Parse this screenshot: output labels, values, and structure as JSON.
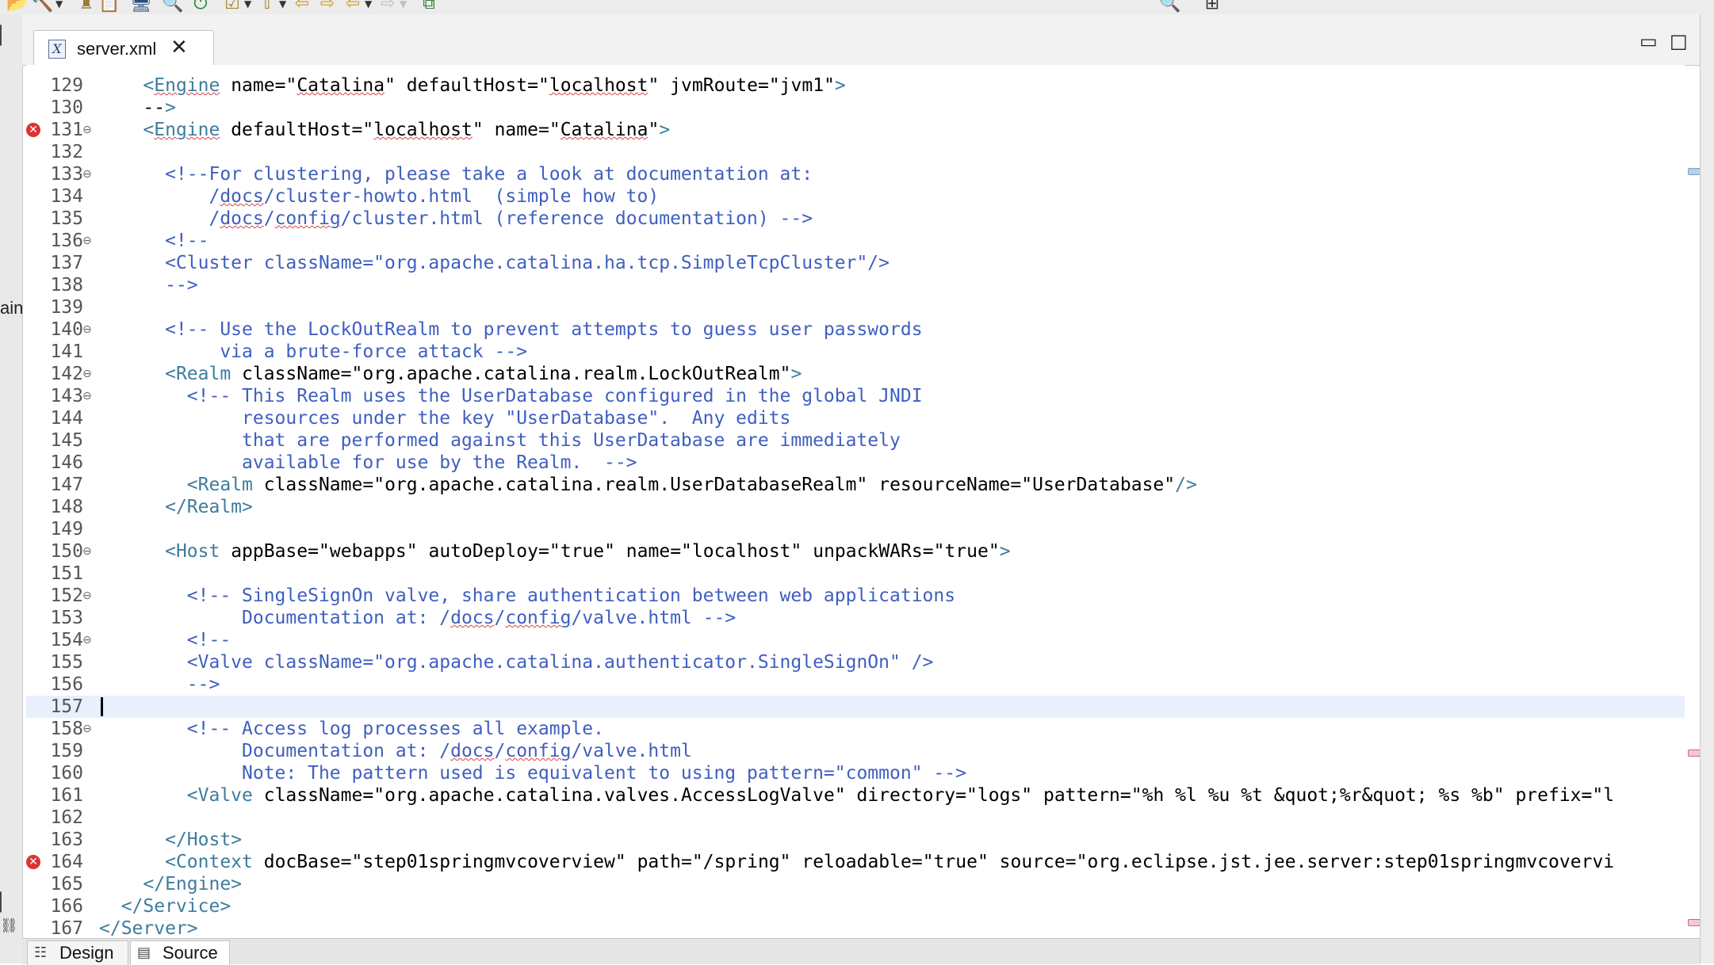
{
  "tab": {
    "label": "server.xml",
    "icon": "xml-file-icon"
  },
  "left_strip": {
    "partial_label": "ain"
  },
  "bottom_tabs": [
    {
      "label": "Design"
    },
    {
      "label": "Source"
    }
  ],
  "editor": {
    "current_line": 157,
    "lines": [
      {
        "num": "129",
        "text": "    <Engine name=\"Catalina\" defaultHost=\"localhost\" jvmRoute=\"jvm1\">"
      },
      {
        "num": "130",
        "text": "    -->"
      },
      {
        "num": "131",
        "text": "    <Engine defaultHost=\"localhost\" name=\"Catalina\">"
      },
      {
        "num": "132",
        "text": ""
      },
      {
        "num": "133",
        "text": "      <!--For clustering, please take a look at documentation at:"
      },
      {
        "num": "134",
        "text": "          /docs/cluster-howto.html  (simple how to)"
      },
      {
        "num": "135",
        "text": "          /docs/config/cluster.html (reference documentation) -->"
      },
      {
        "num": "136",
        "text": "      <!--"
      },
      {
        "num": "137",
        "text": "      <Cluster className=\"org.apache.catalina.ha.tcp.SimpleTcpCluster\"/>"
      },
      {
        "num": "138",
        "text": "      -->"
      },
      {
        "num": "139",
        "text": ""
      },
      {
        "num": "140",
        "text": "      <!-- Use the LockOutRealm to prevent attempts to guess user passwords"
      },
      {
        "num": "141",
        "text": "           via a brute-force attack -->"
      },
      {
        "num": "142",
        "text": "      <Realm className=\"org.apache.catalina.realm.LockOutRealm\">"
      },
      {
        "num": "143",
        "text": "        <!-- This Realm uses the UserDatabase configured in the global JNDI"
      },
      {
        "num": "144",
        "text": "             resources under the key \"UserDatabase\".  Any edits"
      },
      {
        "num": "145",
        "text": "             that are performed against this UserDatabase are immediately"
      },
      {
        "num": "146",
        "text": "             available for use by the Realm.  -->"
      },
      {
        "num": "147",
        "text": "        <Realm className=\"org.apache.catalina.realm.UserDatabaseRealm\" resourceName=\"UserDatabase\"/>"
      },
      {
        "num": "148",
        "text": "      </Realm>"
      },
      {
        "num": "149",
        "text": ""
      },
      {
        "num": "150",
        "text": "      <Host appBase=\"webapps\" autoDeploy=\"true\" name=\"localhost\" unpackWARs=\"true\">"
      },
      {
        "num": "151",
        "text": ""
      },
      {
        "num": "152",
        "text": "        <!-- SingleSignOn valve, share authentication between web applications"
      },
      {
        "num": "153",
        "text": "             Documentation at: /docs/config/valve.html -->"
      },
      {
        "num": "154",
        "text": "        <!--"
      },
      {
        "num": "155",
        "text": "        <Valve className=\"org.apache.catalina.authenticator.SingleSignOn\" />"
      },
      {
        "num": "156",
        "text": "        -->"
      },
      {
        "num": "157",
        "text": ""
      },
      {
        "num": "158",
        "text": "        <!-- Access log processes all example."
      },
      {
        "num": "159",
        "text": "             Documentation at: /docs/config/valve.html"
      },
      {
        "num": "160",
        "text": "             Note: The pattern used is equivalent to using pattern=\"common\" -->"
      },
      {
        "num": "161",
        "text": "        <Valve className=\"org.apache.catalina.valves.AccessLogValve\" directory=\"logs\" pattern=\"%h %l %u %t &quot;%r&quot; %s %b\" prefix=\"l"
      },
      {
        "num": "162",
        "text": ""
      },
      {
        "num": "163",
        "text": "      </Host>"
      },
      {
        "num": "164",
        "text": "      <Context docBase=\"step01springmvcoverview\" path=\"/spring\" reloadable=\"true\" source=\"org.eclipse.jst.jee.server:step01springmvcovervi"
      },
      {
        "num": "165",
        "text": "    </Engine>"
      },
      {
        "num": "166",
        "text": "  </Service>"
      },
      {
        "num": "167",
        "text": "</Server>"
      }
    ]
  }
}
